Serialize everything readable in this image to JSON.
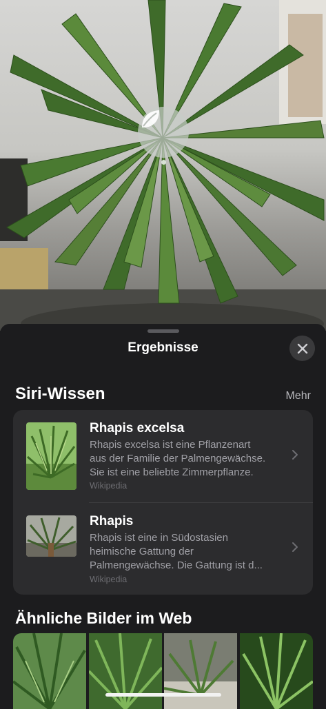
{
  "photo": {
    "subject_icon": "leaf-icon"
  },
  "sheet": {
    "title": "Ergebnisse",
    "close_icon": "close-icon"
  },
  "siri_knowledge": {
    "section_title": "Siri-Wissen",
    "more_label": "Mehr",
    "results": [
      {
        "title": "Rhapis excelsa",
        "description": "Rhapis excelsa ist eine Pflanzenart\naus der Familie der Palmengewächse.\nSie ist eine beliebte Zimmerpflanze.",
        "source": "Wikipedia"
      },
      {
        "title": "Rhapis",
        "description": "Rhapis ist eine in Südostasien\nheimische Gattung der\nPalmengewächse. Die Gattung ist d...",
        "source": "Wikipedia"
      }
    ]
  },
  "similar_images": {
    "section_title": "Ähnliche Bilder im Web"
  },
  "colors": {
    "sheet_background": "#1c1c1e",
    "card_background": "#2c2c2e",
    "secondary_text": "#a0a0a6",
    "tertiary_text": "#6e6e73"
  }
}
